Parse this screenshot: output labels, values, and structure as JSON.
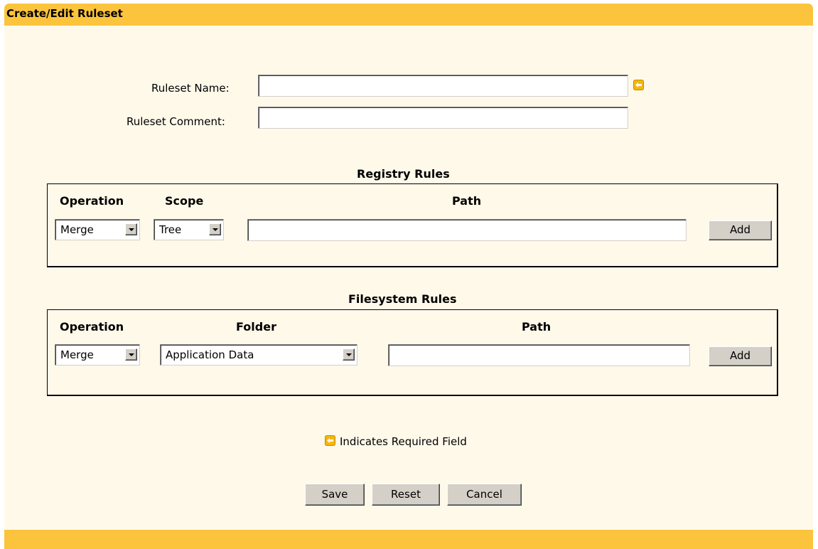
{
  "title": "Create/Edit Ruleset",
  "form": {
    "ruleset_name_label": "Ruleset Name:",
    "ruleset_name_value": "",
    "ruleset_comment_label": "Ruleset Comment:",
    "ruleset_comment_value": ""
  },
  "registry": {
    "title": "Registry Rules",
    "headers": {
      "operation": "Operation",
      "scope": "Scope",
      "path": "Path"
    },
    "operation_value": "Merge",
    "scope_value": "Tree",
    "path_value": "",
    "add_label": "Add"
  },
  "filesystem": {
    "title": "Filesystem Rules",
    "headers": {
      "operation": "Operation",
      "folder": "Folder",
      "path": "Path"
    },
    "operation_value": "Merge",
    "folder_value": "Application Data",
    "path_value": "",
    "add_label": "Add"
  },
  "legend": {
    "text": "Indicates Required Field",
    "icon": "required-arrow-icon"
  },
  "actions": {
    "save": "Save",
    "reset": "Reset",
    "cancel": "Cancel"
  },
  "colors": {
    "header_bar": "#fcc43c",
    "panel_bg": "#fff9ea",
    "required_icon": "#f5b60f"
  }
}
